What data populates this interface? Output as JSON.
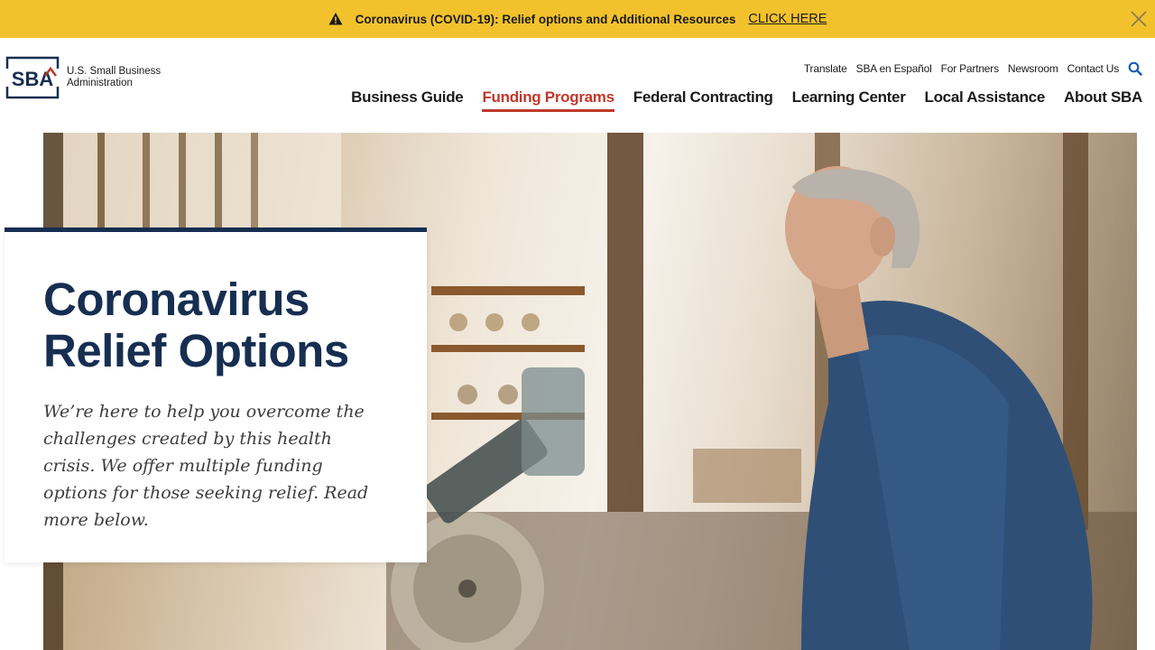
{
  "alert": {
    "message": "Coronavirus (COVID-19): Relief options and Additional Resources",
    "link_label": "CLICK HERE",
    "icon": "warning-icon",
    "close_icon": "close-icon",
    "background": "#f2c22d"
  },
  "header": {
    "logo_letters": "SBA",
    "logo_line1": "U.S. Small Business",
    "logo_line2": "Administration",
    "utility_links": [
      "Translate",
      "SBA en Español",
      "For Partners",
      "Newsroom",
      "Contact Us"
    ],
    "search_icon": "search-icon",
    "nav": [
      {
        "label": "Business Guide",
        "active": false
      },
      {
        "label": "Funding Programs",
        "active": true
      },
      {
        "label": "Federal Contracting",
        "active": false
      },
      {
        "label": "Learning Center",
        "active": false
      },
      {
        "label": "Local Assistance",
        "active": false
      },
      {
        "label": "About SBA",
        "active": false
      }
    ],
    "active_color": "#c0392b"
  },
  "hero": {
    "title": "Coronavirus Relief Options",
    "description": "We’re here to help you overcome the challenges created by this health crisis. We offer multiple funding options for those seeking relief. Read more below.",
    "accent_color": "#162e51"
  }
}
